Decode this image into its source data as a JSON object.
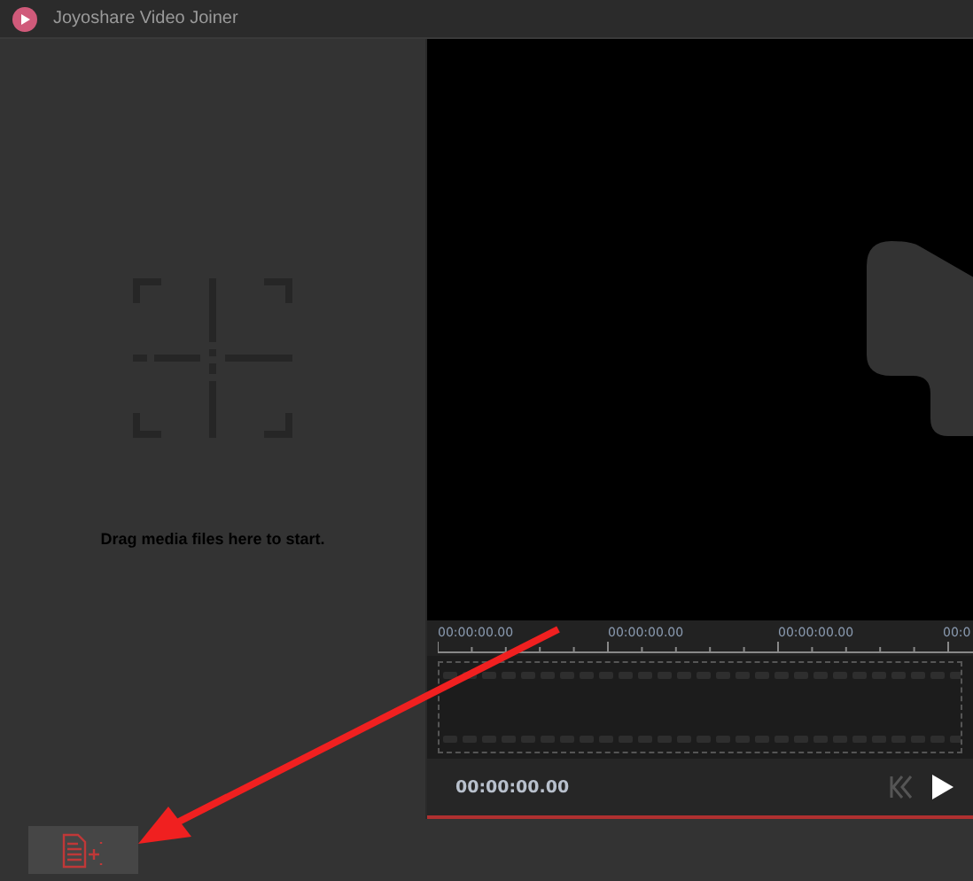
{
  "window": {
    "title": "Joyoshare Video Joiner"
  },
  "media_panel": {
    "hint": "Drag media files here to start."
  },
  "timeline": {
    "ruler_labels": [
      "00:00:00.00",
      "00:00:00.00",
      "00:00:00.00",
      "00:0"
    ]
  },
  "player": {
    "time": "00:00:00.00"
  }
}
